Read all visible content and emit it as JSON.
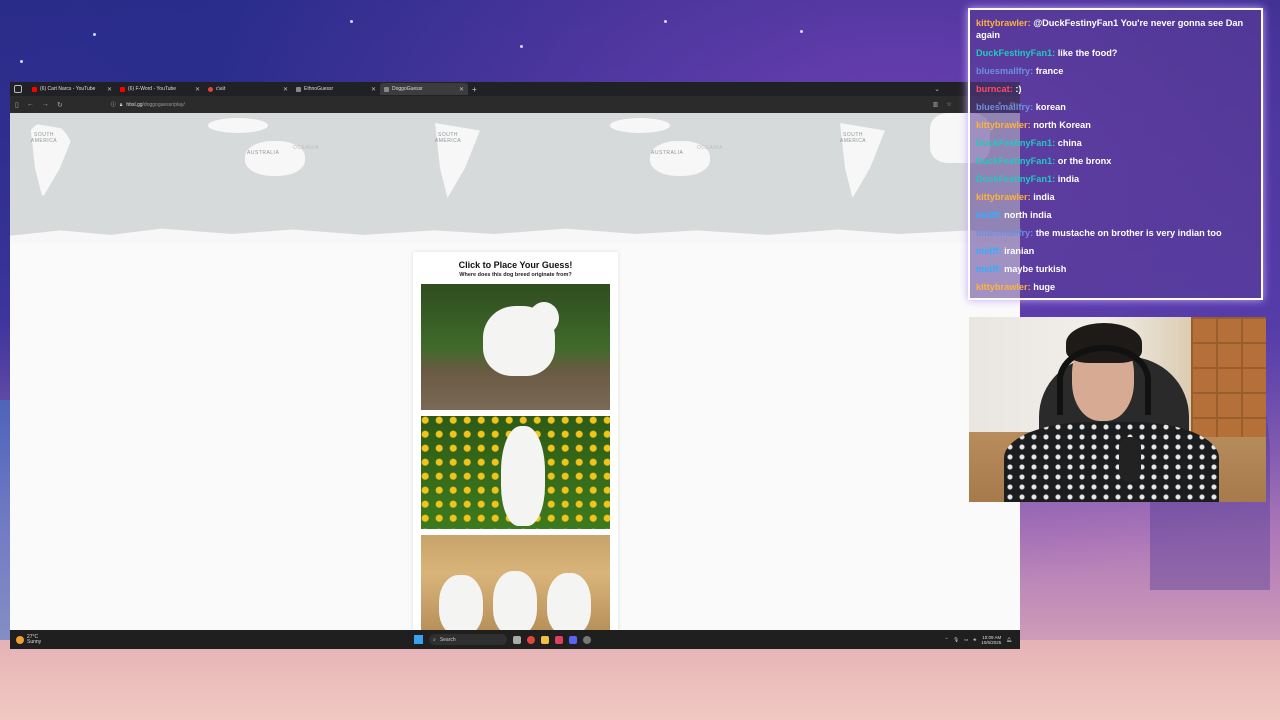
{
  "browser": {
    "tabs": [
      {
        "title": "(6) Cart Narcs - YouTube",
        "favicon_color": "#ff0000",
        "active": false
      },
      {
        "title": "(6) F-Word - YouTube",
        "favicon_color": "#ff0000",
        "active": false
      },
      {
        "title": "c\\a\\t",
        "favicon_color": "#e0473a",
        "active": false
      },
      {
        "title": "EthnoGuessr",
        "favicon_color": "#888888",
        "active": false
      },
      {
        "title": "DoggoGuessr",
        "favicon_color": "#888888",
        "active": true
      }
    ],
    "url_host": "hbsl.gg",
    "url_path": "/doggoguessr/play/"
  },
  "map": {
    "labels": [
      "SOUTH AMERICA",
      "AUSTRALIA",
      "OCEANIA",
      "SOUTH AMERICA",
      "AUSTRALIA",
      "OCEANIA",
      "SOUTH AMERICA"
    ]
  },
  "guess_card": {
    "title": "Click to Place Your Guess!",
    "subtitle": "Where does this dog breed originate from?"
  },
  "taskbar": {
    "temperature": "27°C",
    "weather": "Sunny",
    "search_label": "Search",
    "time": "10:09 AM",
    "date": "10/6/2025"
  },
  "chat": {
    "messages": [
      {
        "user": "kittybrawler",
        "color": "#ffb13b",
        "text": "@DuckFestinyFan1 You're never gonna see Dan again"
      },
      {
        "user": "DuckFestinyFan1",
        "color": "#21c9c0",
        "text": "like the food?"
      },
      {
        "user": "bluesmallfry",
        "color": "#6e8fe0",
        "text": "france"
      },
      {
        "user": "burncat",
        "color": "#ff4a6a",
        "text": ":)"
      },
      {
        "user": "bluesmallfry",
        "color": "#6e8fe0",
        "text": "korean"
      },
      {
        "user": "kittybrawler",
        "color": "#ffb13b",
        "text": "north Korean"
      },
      {
        "user": "DuckFestinyFan1",
        "color": "#21c9c0",
        "text": "china"
      },
      {
        "user": "DuckFestinyFan1",
        "color": "#21c9c0",
        "text": "or the bronx"
      },
      {
        "user": "DuckFestinyFan1",
        "color": "#21c9c0",
        "text": "india"
      },
      {
        "user": "kittybrawler",
        "color": "#ffb13b",
        "text": "india"
      },
      {
        "user": "metff",
        "color": "#2fb0ff",
        "text": "north india"
      },
      {
        "user": "bluesmallfry",
        "color": "#6e8fe0",
        "text": "the mustache on brother is very indian too"
      },
      {
        "user": "metff",
        "color": "#2fb0ff",
        "text": "iranian"
      },
      {
        "user": "metff",
        "color": "#2fb0ff",
        "text": "maybe turkish"
      },
      {
        "user": "kittybrawler",
        "color": "#ffb13b",
        "text": "huge"
      }
    ]
  }
}
